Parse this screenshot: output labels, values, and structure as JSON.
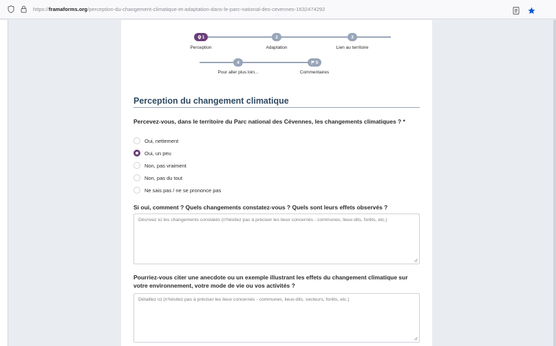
{
  "browser": {
    "url_prefix": "https://",
    "url_domain": "framaforms.org",
    "url_path": "/perception-du-changement-climatique-et-adaptation-dans-le-parc-national-des-cevennes-1632474292"
  },
  "steps": [
    {
      "number": "1",
      "label": "Perception"
    },
    {
      "number": "2",
      "label": "Adaptation"
    },
    {
      "number": "3",
      "label": "Lien au territoire"
    },
    {
      "number": "4",
      "label": "Pour aller plus loin..."
    },
    {
      "number": "5",
      "label": "Commentaires"
    }
  ],
  "section": {
    "title": "Perception du changement climatique"
  },
  "q1": {
    "text": "Percevez-vous, dans le territoire du Parc national des Cévennes, les changements climatiques ? *",
    "options": [
      {
        "label": "Oui, nettement",
        "checked": false
      },
      {
        "label": "Oui, un peu",
        "checked": true
      },
      {
        "label": "Non, pas vraiment",
        "checked": false
      },
      {
        "label": "Non, pas du tout",
        "checked": false
      },
      {
        "label": "Ne sais pas / ne se prononce pas",
        "checked": false
      }
    ]
  },
  "q2": {
    "text": "Si oui, comment ? Quels changements constatez-vous ? Quels sont leurs effets observés ?",
    "placeholder": "Décrivez ici les changements constatés (n'hésitez pas à préciser les lieux concernés - communes, lieux-dits, forêts, etc.)"
  },
  "q3": {
    "text": "Pourriez-vous citer une anecdote ou un exemple illustrant les effets du changement climatique sur votre environnement, votre mode de vie ou vos activités ?",
    "placeholder": "Détaillez ici (n'hésitez pas à préciser les lieux concernés - communes, lieux-dits, secteurs, forêts, etc.)"
  },
  "colors": {
    "accent": "#6b3f79",
    "step_inactive": "#98a5b8",
    "title": "#2f4a62"
  }
}
